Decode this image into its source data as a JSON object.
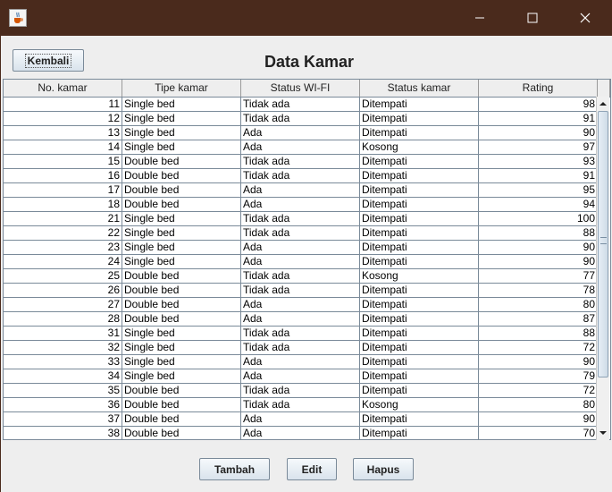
{
  "window": {
    "app_icon": "java-cup-icon",
    "controls": [
      "minimize-icon",
      "maximize-icon",
      "close-icon"
    ]
  },
  "toolbar": {
    "back_label": "Kembali"
  },
  "page": {
    "title": "Data Kamar"
  },
  "table": {
    "columns": [
      "No. kamar",
      "Tipe kamar",
      "Status WI-FI",
      "Status kamar",
      "Rating"
    ],
    "rows": [
      [
        "11",
        "Single bed",
        "Tidak ada",
        "Ditempati",
        "98"
      ],
      [
        "12",
        "Single bed",
        "Tidak ada",
        "Ditempati",
        "91"
      ],
      [
        "13",
        "Single bed",
        "Ada",
        "Ditempati",
        "90"
      ],
      [
        "14",
        "Single bed",
        "Ada",
        "Kosong",
        "97"
      ],
      [
        "15",
        "Double bed",
        "Tidak ada",
        "Ditempati",
        "93"
      ],
      [
        "16",
        "Double bed",
        "Tidak ada",
        "Ditempati",
        "91"
      ],
      [
        "17",
        "Double bed",
        "Ada",
        "Ditempati",
        "95"
      ],
      [
        "18",
        "Double bed",
        "Ada",
        "Ditempati",
        "94"
      ],
      [
        "21",
        "Single bed",
        "Tidak ada",
        "Ditempati",
        "100"
      ],
      [
        "22",
        "Single bed",
        "Tidak ada",
        "Ditempati",
        "88"
      ],
      [
        "23",
        "Single bed",
        "Ada",
        "Ditempati",
        "90"
      ],
      [
        "24",
        "Single bed",
        "Ada",
        "Ditempati",
        "90"
      ],
      [
        "25",
        "Double bed",
        "Tidak ada",
        "Kosong",
        "77"
      ],
      [
        "26",
        "Double bed",
        "Tidak ada",
        "Ditempati",
        "78"
      ],
      [
        "27",
        "Double bed",
        "Ada",
        "Ditempati",
        "80"
      ],
      [
        "28",
        "Double bed",
        "Ada",
        "Ditempati",
        "87"
      ],
      [
        "31",
        "Single bed",
        "Tidak ada",
        "Ditempati",
        "88"
      ],
      [
        "32",
        "Single bed",
        "Tidak ada",
        "Ditempati",
        "72"
      ],
      [
        "33",
        "Single bed",
        "Ada",
        "Ditempati",
        "90"
      ],
      [
        "34",
        "Single bed",
        "Ada",
        "Ditempati",
        "79"
      ],
      [
        "35",
        "Double bed",
        "Tidak ada",
        "Ditempati",
        "72"
      ],
      [
        "36",
        "Double bed",
        "Tidak ada",
        "Kosong",
        "80"
      ],
      [
        "37",
        "Double bed",
        "Ada",
        "Ditempati",
        "90"
      ],
      [
        "38",
        "Double bed",
        "Ada",
        "Ditempati",
        "70"
      ]
    ]
  },
  "actions": {
    "add_label": "Tambah",
    "edit_label": "Edit",
    "delete_label": "Hapus"
  },
  "colors": {
    "titlebar": "#4a2a1c",
    "window_bg": "#eeeeee",
    "grid": "#7a8a99"
  }
}
